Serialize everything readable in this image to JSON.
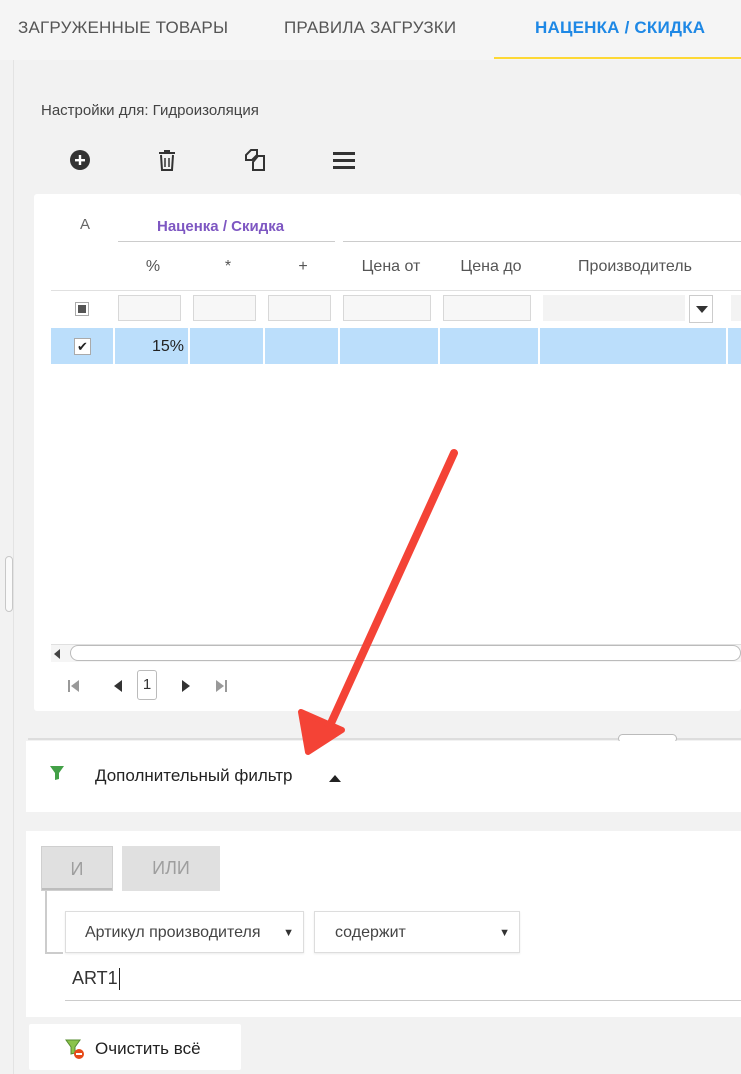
{
  "tabs": [
    {
      "label": "ЗАГРУЖЕННЫЕ ТОВАРЫ",
      "active": false
    },
    {
      "label": "ПРАВИЛА ЗАГРУЗКИ",
      "active": false
    },
    {
      "label": "НАЦЕНКА / СКИДКА",
      "active": true
    }
  ],
  "colors": {
    "accent": "#1e88e5",
    "tab_underline": "#fdd835",
    "group_header": "#7e57c2",
    "selected_row": "#bbdefb",
    "filter_icon": "#43a047",
    "annotation_arrow": "#f44336"
  },
  "settings_label": "Настройки для: Гидроизоляция",
  "toolbar": {
    "icons": [
      "add-circle-icon",
      "trash-icon",
      "copy-icon",
      "menu-icon"
    ]
  },
  "grid": {
    "col_a": "A",
    "group_header": "Наценка / Скидка",
    "columns": [
      "%",
      "*",
      "+",
      "Цена от",
      "Цена до",
      "Производитель"
    ],
    "rows": [
      {
        "checked": true,
        "percent": "15%",
        "multiply": "",
        "add": "",
        "price_from": "",
        "price_to": "",
        "manufacturer": ""
      }
    ],
    "pager": {
      "page": "1"
    }
  },
  "extra_filter": {
    "title": "Дополнительный фильтр",
    "expanded": true,
    "logic": {
      "and_label": "И",
      "or_label": "ИЛИ",
      "selected": "И"
    },
    "condition": {
      "field": "Артикул производителя",
      "operator": "содержит",
      "value": "ART1"
    }
  },
  "clear_all_label": "Очистить всё"
}
